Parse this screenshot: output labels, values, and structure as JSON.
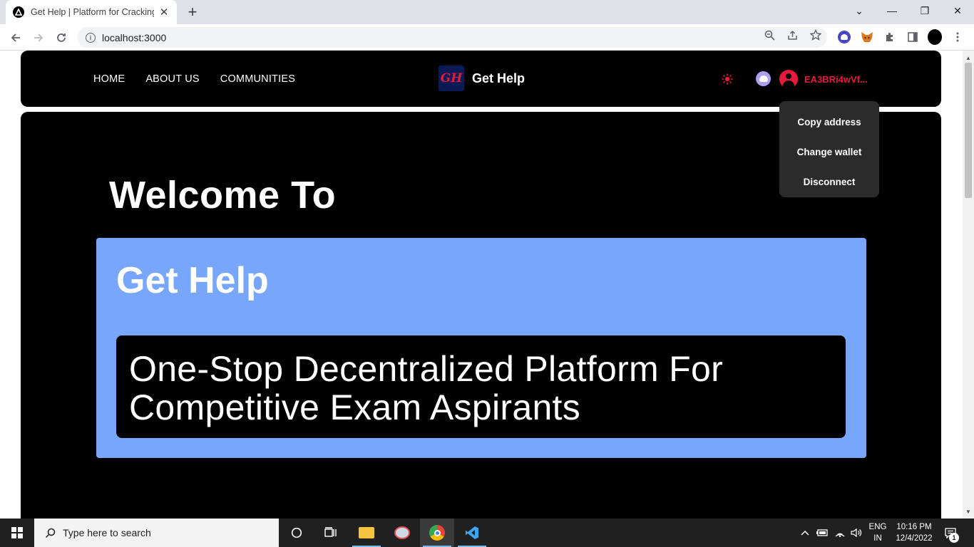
{
  "browser": {
    "tab_title": "Get Help | Platform for Cracking C",
    "tab_close": "✕",
    "new_tab": "+",
    "url": "localhost:3000",
    "window_controls": {
      "minimize": "—",
      "maximize": "❐",
      "close": "✕",
      "tab_search": "⌄"
    }
  },
  "header": {
    "nav": [
      "HOME",
      "ABOUT US",
      "COMMUNITIES"
    ],
    "logo_text": "GH",
    "brand": "Get Help",
    "account_address": "EA3BRi4wVf...",
    "accent_color": "#e8193c"
  },
  "wallet_menu": {
    "items": [
      "Copy address",
      "Change wallet",
      "Disconnect"
    ]
  },
  "hero": {
    "welcome": "Welcome To",
    "title": "Get Help",
    "tagline": "One-Stop Decentralized Platform For Competitive Exam Aspirants",
    "card_color": "#78a6fa"
  },
  "taskbar": {
    "search_placeholder": "Type here to search",
    "lang_top": "ENG",
    "lang_bottom": "IN",
    "time": "10:16 PM",
    "date": "12/4/2022",
    "notification_count": "1"
  }
}
